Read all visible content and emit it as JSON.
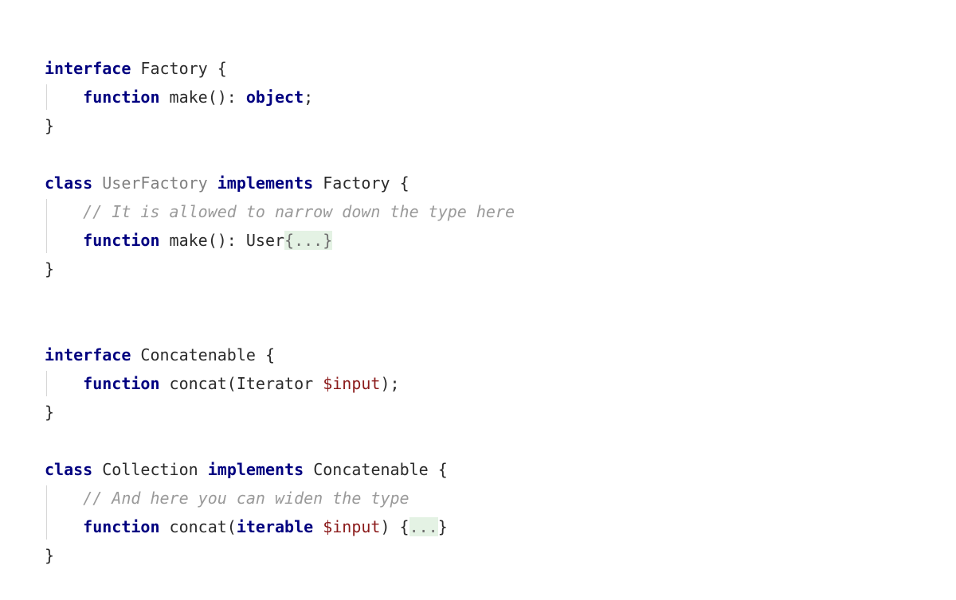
{
  "meta": {
    "background": "#ffffff",
    "separator_color": "#c4c4c4",
    "indent_guide_color": "#d6d6d6"
  },
  "theme": {
    "keyword": "#000080",
    "identifier": "#2b2b2b",
    "identifier_dim": "#808080",
    "variable": "#8b1a1a",
    "comment": "#9a9a9a",
    "fold_text": "#6e6e6e",
    "fold_background": "#e4f2e4"
  },
  "blocks": [
    {
      "id": "factory-interface",
      "lines": [
        {
          "tokens": [
            {
              "t": "interface",
              "k": "kw"
            },
            {
              "t": " ",
              "k": "plain"
            },
            {
              "t": "Factory",
              "k": "ident"
            },
            {
              "t": " {",
              "k": "punct"
            }
          ]
        },
        {
          "indented": true,
          "tokens": [
            {
              "t": "    ",
              "k": "plain"
            },
            {
              "t": "function",
              "k": "kw"
            },
            {
              "t": " ",
              "k": "plain"
            },
            {
              "t": "make",
              "k": "ident"
            },
            {
              "t": "(): ",
              "k": "punct"
            },
            {
              "t": "object",
              "k": "kw"
            },
            {
              "t": ";",
              "k": "punct"
            }
          ]
        },
        {
          "tokens": [
            {
              "t": "}",
              "k": "punct"
            }
          ]
        }
      ]
    },
    {
      "id": "user-factory-class",
      "lines": [
        {
          "tokens": [
            {
              "t": "class",
              "k": "kw"
            },
            {
              "t": " ",
              "k": "plain"
            },
            {
              "t": "UserFactory",
              "k": "ident-dim"
            },
            {
              "t": " ",
              "k": "plain"
            },
            {
              "t": "implements",
              "k": "kw"
            },
            {
              "t": " ",
              "k": "plain"
            },
            {
              "t": "Factory",
              "k": "ident"
            },
            {
              "t": " {",
              "k": "punct"
            }
          ]
        },
        {
          "indented": true,
          "tokens": [
            {
              "t": "    ",
              "k": "plain"
            },
            {
              "t": "// It is allowed to narrow down the type here",
              "k": "cmt"
            }
          ]
        },
        {
          "indented": true,
          "tokens": [
            {
              "t": "    ",
              "k": "plain"
            },
            {
              "t": "function",
              "k": "kw"
            },
            {
              "t": " ",
              "k": "plain"
            },
            {
              "t": "make",
              "k": "ident"
            },
            {
              "t": "(): ",
              "k": "punct"
            },
            {
              "t": "User",
              "k": "ident"
            },
            {
              "t": "{...}",
              "k": "fold"
            }
          ]
        },
        {
          "tokens": [
            {
              "t": "}",
              "k": "punct"
            }
          ]
        }
      ]
    },
    {
      "id": "concatenable-interface",
      "lines": [
        {
          "tokens": [
            {
              "t": "interface",
              "k": "kw"
            },
            {
              "t": " ",
              "k": "plain"
            },
            {
              "t": "Concatenable",
              "k": "ident"
            },
            {
              "t": " {",
              "k": "punct"
            }
          ]
        },
        {
          "indented": true,
          "tokens": [
            {
              "t": "    ",
              "k": "plain"
            },
            {
              "t": "function",
              "k": "kw"
            },
            {
              "t": " ",
              "k": "plain"
            },
            {
              "t": "concat",
              "k": "ident"
            },
            {
              "t": "(",
              "k": "punct"
            },
            {
              "t": "Iterator",
              "k": "ident"
            },
            {
              "t": " ",
              "k": "plain"
            },
            {
              "t": "$input",
              "k": "var"
            },
            {
              "t": ");",
              "k": "punct"
            }
          ]
        },
        {
          "tokens": [
            {
              "t": "}",
              "k": "punct"
            }
          ]
        }
      ]
    },
    {
      "id": "collection-class",
      "lines": [
        {
          "tokens": [
            {
              "t": "class",
              "k": "kw"
            },
            {
              "t": " ",
              "k": "plain"
            },
            {
              "t": "Collection",
              "k": "ident"
            },
            {
              "t": " ",
              "k": "plain"
            },
            {
              "t": "implements",
              "k": "kw"
            },
            {
              "t": " ",
              "k": "plain"
            },
            {
              "t": "Concatenable",
              "k": "ident"
            },
            {
              "t": " {",
              "k": "punct"
            }
          ]
        },
        {
          "indented": true,
          "tokens": [
            {
              "t": "    ",
              "k": "plain"
            },
            {
              "t": "// And here you can widen the type",
              "k": "cmt"
            }
          ]
        },
        {
          "indented": true,
          "tokens": [
            {
              "t": "    ",
              "k": "plain"
            },
            {
              "t": "function",
              "k": "kw"
            },
            {
              "t": " ",
              "k": "plain"
            },
            {
              "t": "concat",
              "k": "ident"
            },
            {
              "t": "(",
              "k": "punct"
            },
            {
              "t": "iterable",
              "k": "kw"
            },
            {
              "t": " ",
              "k": "plain"
            },
            {
              "t": "$input",
              "k": "var"
            },
            {
              "t": ") {",
              "k": "brace-plain"
            },
            {
              "t": "...",
              "k": "fold"
            },
            {
              "t": "}",
              "k": "brace-plain"
            }
          ]
        },
        {
          "tokens": [
            {
              "t": "}",
              "k": "punct"
            }
          ]
        }
      ]
    }
  ]
}
